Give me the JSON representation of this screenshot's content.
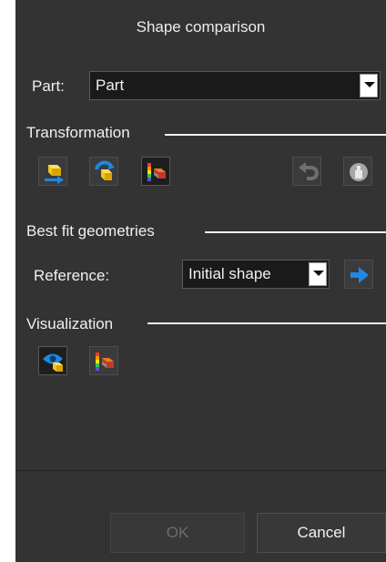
{
  "dialog": {
    "title": "Shape comparison"
  },
  "part": {
    "label": "Part:",
    "selected": "Part"
  },
  "transformation": {
    "title": "Transformation",
    "buttons": [
      {
        "icon": "move-part-icon"
      },
      {
        "icon": "rotate-part-icon"
      },
      {
        "icon": "color-map-icon"
      },
      {
        "icon": "undo-icon",
        "state": "disabled"
      },
      {
        "icon": "reset-icon",
        "state": "disabled"
      }
    ]
  },
  "best_fit": {
    "title": "Best fit geometries",
    "reference_label": "Reference:",
    "reference_selected": "Initial shape",
    "apply_icon": "arrow-right-icon"
  },
  "visualization": {
    "title": "Visualization",
    "buttons": [
      {
        "icon": "visibility-toggle-icon",
        "state": "pressed"
      },
      {
        "icon": "color-map-icon"
      }
    ]
  },
  "footer": {
    "ok_label": "OK",
    "cancel_label": "Cancel"
  },
  "colors": {
    "background": "#333333",
    "accent": "#1e88e5",
    "gold": "#f5c518"
  }
}
